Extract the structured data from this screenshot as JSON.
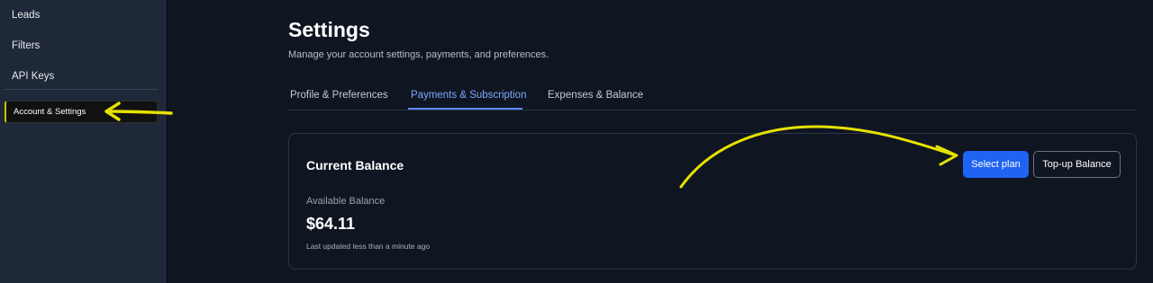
{
  "sidebar": {
    "items": [
      {
        "label": "Leads"
      },
      {
        "label": "Filters"
      },
      {
        "label": "API Keys"
      },
      {
        "label": "Account & Settings"
      }
    ]
  },
  "header": {
    "title": "Settings",
    "subtitle": "Manage your account settings, payments, and preferences."
  },
  "tabs": [
    {
      "label": "Profile & Preferences"
    },
    {
      "label": "Payments & Subscription",
      "active": true
    },
    {
      "label": "Expenses & Balance"
    }
  ],
  "balance_card": {
    "title": "Current Balance",
    "available_label": "Available Balance",
    "amount": "$64.11",
    "updated_text": "Last updated less than a minute ago",
    "select_plan_label": "Select plan",
    "topup_label": "Top-up Balance"
  },
  "colors": {
    "background": "#0f1621",
    "sidebar": "#1e2838",
    "accent": "#1f63f2",
    "active_tab": "#7da7ff",
    "annotation": "#e6e200"
  }
}
